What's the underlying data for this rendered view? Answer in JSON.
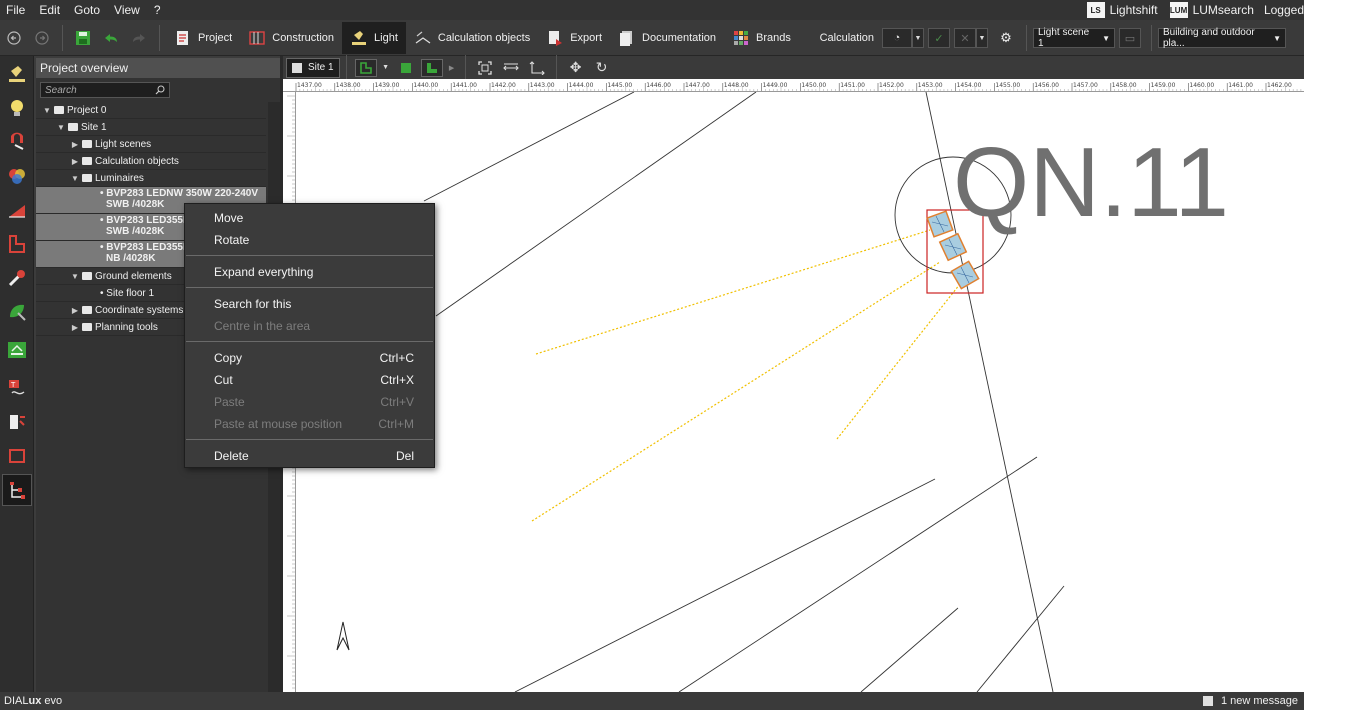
{
  "menu": {
    "items": [
      "File",
      "Edit",
      "Goto",
      "View",
      "?"
    ],
    "right": [
      {
        "logo": "LS",
        "label": "Lightshift"
      },
      {
        "logo": "LUM",
        "label": "LUMsearch"
      }
    ],
    "logged": "Logged"
  },
  "toolbar": {
    "tabs": [
      {
        "label": "Project"
      },
      {
        "label": "Construction"
      },
      {
        "label": "Light"
      },
      {
        "label": "Calculation objects"
      },
      {
        "label": "Export"
      },
      {
        "label": "Documentation"
      },
      {
        "label": "Brands"
      }
    ],
    "active_tab": "Light",
    "calculation_label": "Calculation",
    "light_scene": "Light scene 1",
    "plan_mode": "Building and outdoor pla..."
  },
  "panel": {
    "title": "Project overview",
    "search_placeholder": "Search",
    "tree": {
      "project": "Project 0",
      "site": "Site 1",
      "light_scenes": "Light scenes",
      "calc_objects": "Calculation objects",
      "luminaires": "Luminaires",
      "lum1_line1": "• BVP283 LEDNW 350W 220-240V",
      "lum1_line2": "SWB /4028K",
      "lum2_line1": "• BVP283 LED355NW",
      "lum2_line2": "SWB /4028K",
      "lum3_line1": "• BVP283 LED355NW",
      "lum3_line2": "NB /4028K",
      "ground": "Ground elements",
      "floor": "• Site floor 1",
      "coords": "Coordinate systems",
      "planning": "Planning tools"
    }
  },
  "view": {
    "site_tab": "Site 1"
  },
  "ruler": {
    "top_labels": [
      "1437.00",
      "1438.00",
      "1439.00",
      "1440.00",
      "1441.00",
      "1442.00",
      "1443.00",
      "1444.00",
      "1445.00",
      "1446.00",
      "1447.00",
      "1448.00",
      "1449.00",
      "1450.00",
      "1451.00",
      "1452.00",
      "1453.00",
      "1454.00",
      "1455.00",
      "1456.00",
      "1457.00",
      "1458.00",
      "1459.00",
      "1460.00",
      "1461.00",
      "1462.00"
    ]
  },
  "canvas": {
    "label": "QN.11"
  },
  "context_menu": {
    "move": "Move",
    "rotate": "Rotate",
    "expand": "Expand everything",
    "search": "Search for this",
    "centre": "Centre in the area",
    "copy": "Copy",
    "copy_sc": "Ctrl+C",
    "cut": "Cut",
    "cut_sc": "Ctrl+X",
    "paste": "Paste",
    "paste_sc": "Ctrl+V",
    "paste_mouse": "Paste at mouse position",
    "paste_mouse_sc": "Ctrl+M",
    "delete": "Delete",
    "delete_sc": "Del"
  },
  "status": {
    "logo_a": "DIAL",
    "logo_b": "ux",
    "logo_c": " evo",
    "message": "1 new message"
  },
  "colors": {
    "accent_green": "#3aa63a",
    "selection_red": "#cc2222",
    "light_cone": "#f0c000"
  }
}
